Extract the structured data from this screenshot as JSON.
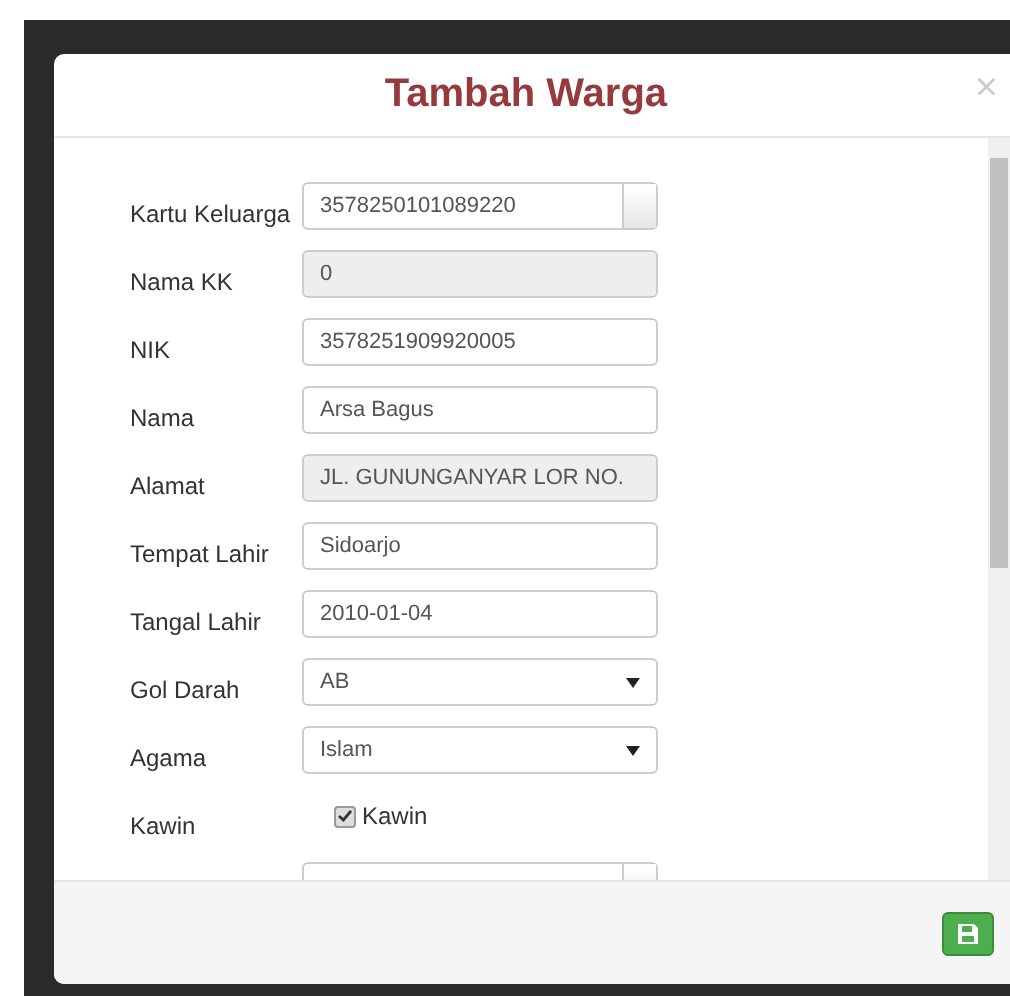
{
  "modal": {
    "title": "Tambah Warga",
    "close": "×"
  },
  "fields": [
    {
      "label": "Kartu Keluarga",
      "kind": "lookup",
      "value": "3578250101089220"
    },
    {
      "label": "Nama KK",
      "kind": "readonly",
      "value": "0"
    },
    {
      "label": "NIK",
      "kind": "text",
      "value": "3578251909920005"
    },
    {
      "label": "Nama",
      "kind": "text",
      "value": "Arsa Bagus"
    },
    {
      "label": "Alamat",
      "kind": "readonly",
      "value": "JL. GUNUNGANYAR LOR NO."
    },
    {
      "label": "Tempat Lahir",
      "kind": "text",
      "value": "Sidoarjo"
    },
    {
      "label": "Tangal Lahir",
      "kind": "text",
      "value": "2010-01-04"
    },
    {
      "label": "Gol Darah",
      "kind": "select",
      "value": "AB"
    },
    {
      "label": "Agama",
      "kind": "select",
      "value": "Islam"
    },
    {
      "label": "Kawin",
      "kind": "checkbox",
      "value": "Kawin",
      "checked": true
    },
    {
      "kind": "lookup"
    }
  ]
}
